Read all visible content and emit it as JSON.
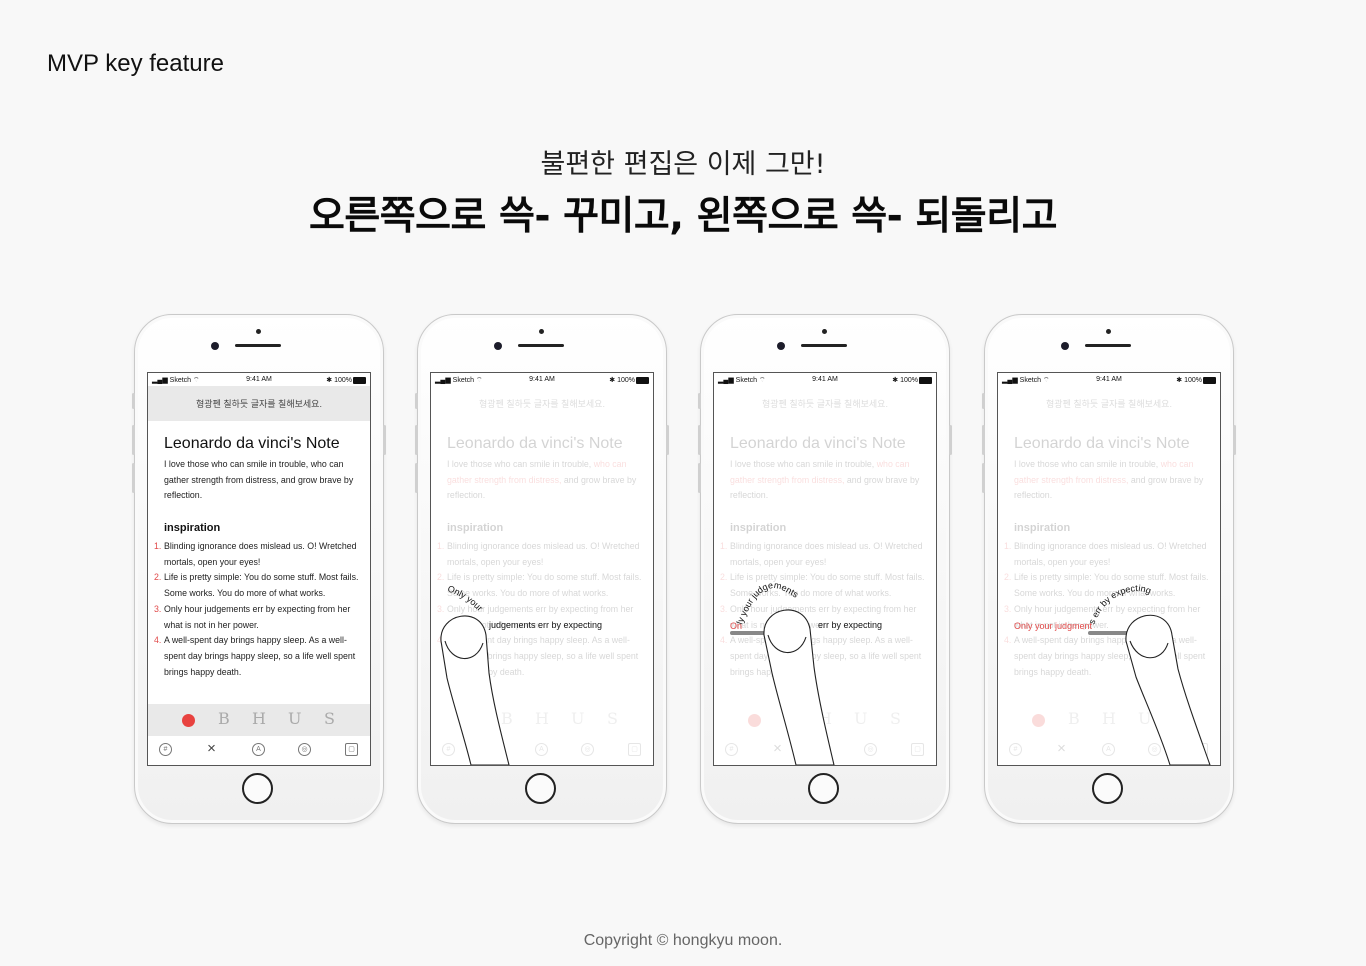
{
  "page": {
    "label": "MVP key feature",
    "subtitle": "불편한 편집은 이제 그만!",
    "title": "오른쪽으로 쓱- 꾸미고, 왼쪽으로 쓱- 되돌리고",
    "copyright": "Copyright © hongkyu moon."
  },
  "status_bar": {
    "carrier": "Sketch",
    "time": "9:41 AM",
    "battery": "100%"
  },
  "note": {
    "hint": "형광펜 칠하듯 글자를 칠해보세요.",
    "title": "Leonardo da vinci's Note",
    "intro": "I love those who can smile in trouble, who can gather strength from distress, and grow brave by reflection.",
    "intro_plain": "I love those who can smile in trouble, ",
    "intro_highlight": "who can gather strength from distress,",
    "intro_end": " and grow brave by reflection.",
    "section": "inspiration",
    "items": [
      {
        "num": "1.",
        "text": "Blinding ignorance does mislead us. O! Wretched mortals, open your eyes!"
      },
      {
        "num": "2.",
        "text": "Life is pretty simple: You do some stuff. Most fails. Some works. You do more of what works."
      },
      {
        "num": "3.",
        "text": "Only hour judgements err by expecting from her what is not in her power."
      },
      {
        "num": "4.",
        "text": "A well-spent day brings happy sleep. As a well-spent day brings happy sleep, so a life well spent brings happy death."
      }
    ]
  },
  "toolbar": {
    "bold": "B",
    "heading": "H",
    "underline": "U",
    "strike": "S"
  },
  "bottom_bar": {
    "hash": "#",
    "close": "×",
    "font": "A",
    "palette": "◎",
    "clip": "▢"
  },
  "gestures": {
    "phone2": {
      "curved": "Only your",
      "rest": "judgements err by expecting"
    },
    "phone3": {
      "start": "On",
      "curved": "ly your judgements",
      "rest": "err by expecting"
    },
    "phone4": {
      "start": "Only your judgment",
      "curved": "s err by expecting"
    }
  },
  "colors": {
    "accent": "#e14b4b",
    "record": "#e8423f"
  }
}
